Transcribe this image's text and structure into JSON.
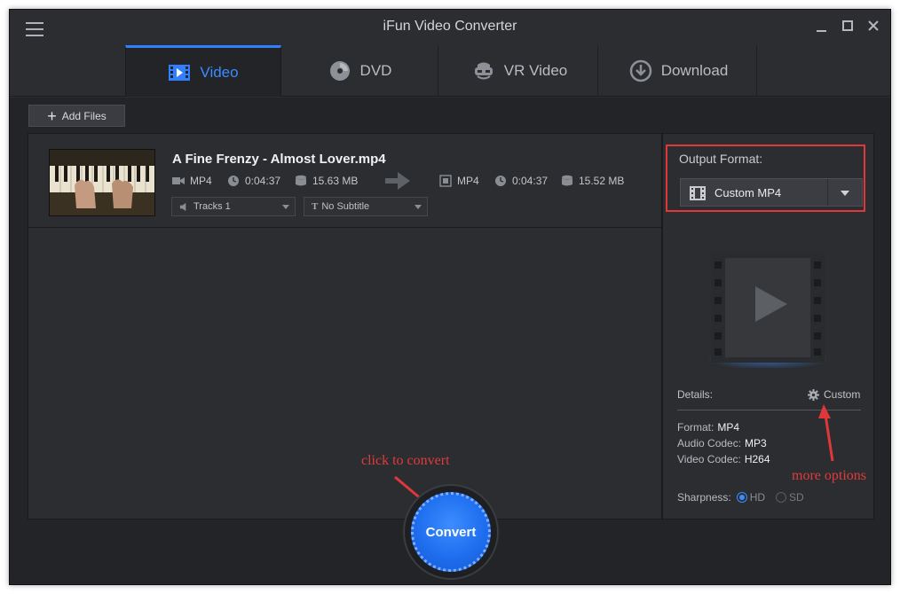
{
  "app": {
    "title": "iFun Video Converter"
  },
  "tabs": [
    {
      "label": "Video",
      "icon": "video-icon",
      "active": true
    },
    {
      "label": "DVD",
      "icon": "dvd-icon",
      "active": false
    },
    {
      "label": "VR Video",
      "icon": "vr-headset-icon",
      "active": false
    },
    {
      "label": "Download",
      "icon": "download-icon",
      "active": false
    }
  ],
  "toolbar": {
    "add_files": "Add Files"
  },
  "file": {
    "name": "A Fine Frenzy - Almost Lover.mp4",
    "source": {
      "format": "MP4",
      "duration": "0:04:37",
      "size": "15.63 MB"
    },
    "target": {
      "format": "MP4",
      "duration": "0:04:37",
      "size": "15.52 MB"
    },
    "audio_track": "Tracks 1",
    "subtitle": "No Subtitle"
  },
  "output": {
    "label": "Output Format:",
    "selected": "Custom MP4",
    "details_label": "Details:",
    "custom_label": "Custom",
    "format_label": "Format:",
    "format_value": "MP4",
    "audio_codec_label": "Audio Codec:",
    "audio_codec_value": "MP3",
    "video_codec_label": "Video Codec:",
    "video_codec_value": "H264",
    "sharpness_label": "Sharpness:",
    "sharpness_hd": "HD",
    "sharpness_sd": "SD",
    "sharpness_selected": "HD"
  },
  "convert": {
    "label": "Convert"
  },
  "annotations": {
    "click_to_convert": "click to convert",
    "more_options": "more options"
  },
  "colors": {
    "accent": "#2f7fff",
    "annotation": "#e0373a",
    "background": "#2b2d31"
  }
}
